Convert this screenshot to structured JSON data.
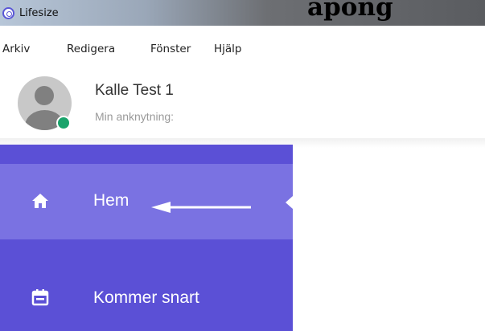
{
  "window": {
    "title": "Lifesize",
    "overlay_heading": "apong"
  },
  "menu": [
    "Arkiv",
    "Redigera",
    "Fönster",
    "Hjälp"
  ],
  "profile": {
    "name": "Kalle Test 1",
    "extension_label": "Min anknytning:",
    "status_color": "#1aa36b"
  },
  "sidebar": {
    "accent": "#5b50d6",
    "items": [
      {
        "label": "Hem",
        "icon": "home-icon",
        "active": true
      },
      {
        "label": "Kommer snart",
        "icon": "calendar-icon",
        "active": false
      }
    ]
  },
  "annotation": {
    "icon": "left-arrow-icon",
    "color": "#ffffff"
  }
}
